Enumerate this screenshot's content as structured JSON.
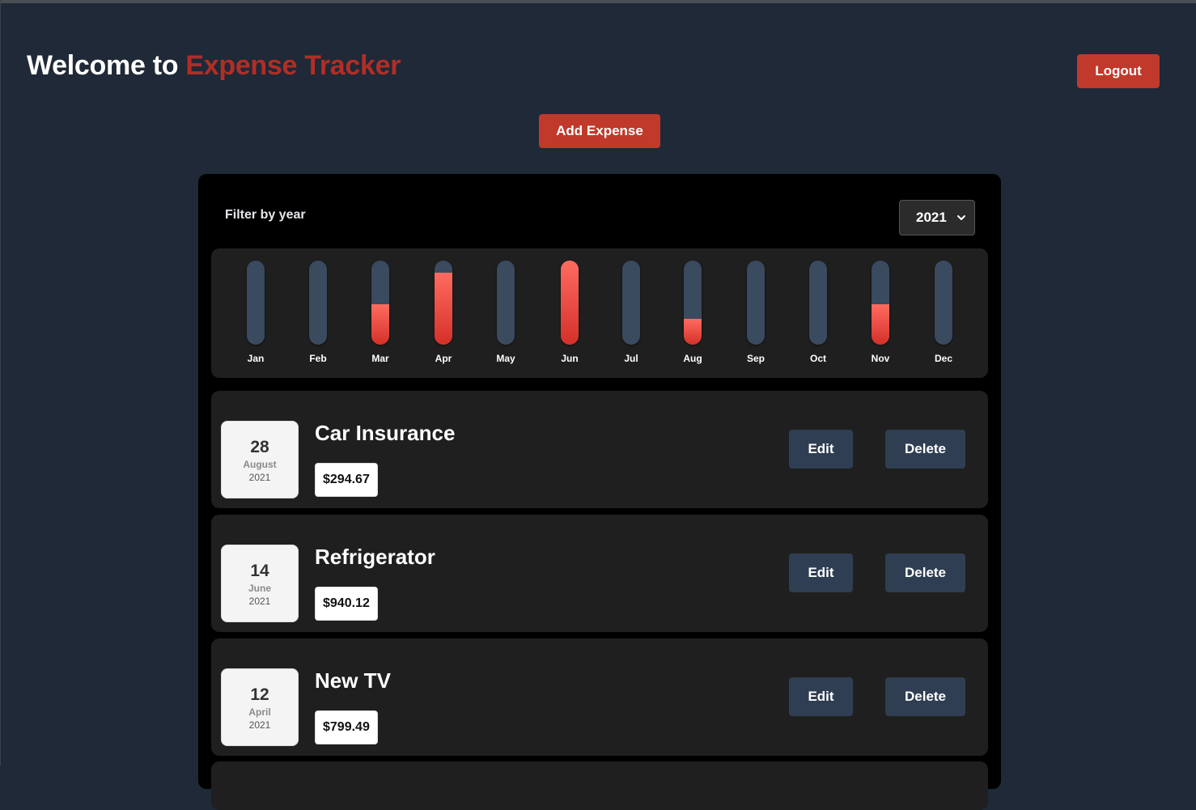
{
  "header": {
    "title_prefix": "Welcome to",
    "title_accent": "Expense Tracker",
    "logout_label": "Logout",
    "accent_color": "#b02e26"
  },
  "actions": {
    "add_expense_label": "Add Expense"
  },
  "filter": {
    "label": "Filter by year",
    "selected_year": "2021",
    "icon": "chevron-down-icon"
  },
  "chart_data": {
    "type": "bar",
    "categories": [
      "Jan",
      "Feb",
      "Mar",
      "Apr",
      "May",
      "Jun",
      "Jul",
      "Aug",
      "Sep",
      "Oct",
      "Nov",
      "Dec"
    ],
    "fill_fraction": [
      0,
      0,
      0.48,
      0.86,
      0,
      1.0,
      0,
      0.31,
      0,
      0,
      0.48,
      0
    ]
  },
  "expenses": [
    {
      "title": "Car Insurance",
      "amount": "$294.67",
      "day": "28",
      "month": "August",
      "year": "2021",
      "edit_label": "Edit",
      "delete_label": "Delete"
    },
    {
      "title": "Refrigerator",
      "amount": "$940.12",
      "day": "14",
      "month": "June",
      "year": "2021",
      "edit_label": "Edit",
      "delete_label": "Delete"
    },
    {
      "title": "New TV",
      "amount": "$799.49",
      "day": "12",
      "month": "April",
      "year": "2021",
      "edit_label": "Edit",
      "delete_label": "Delete"
    }
  ]
}
